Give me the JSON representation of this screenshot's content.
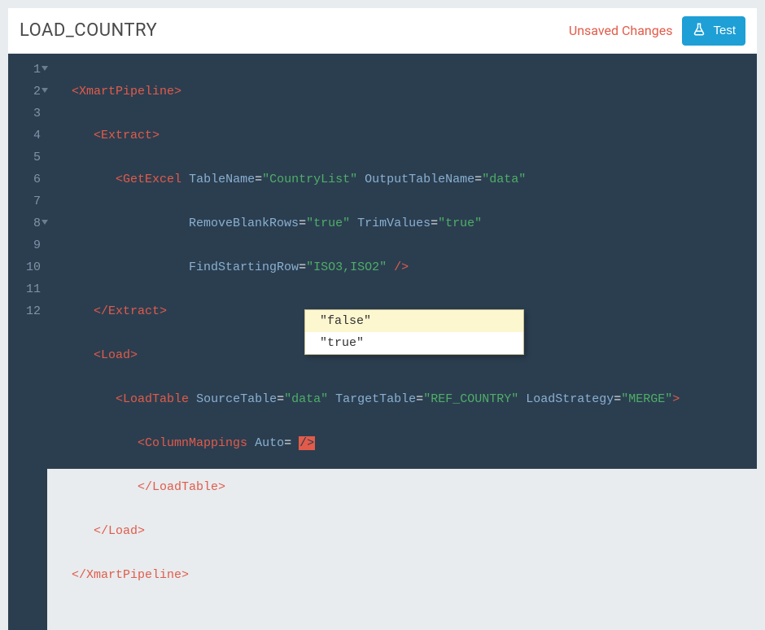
{
  "header": {
    "title": "LOAD_COUNTRY",
    "unsaved_label": "Unsaved Changes",
    "test_label": "Test"
  },
  "editor": {
    "line_numbers": [
      "1",
      "2",
      "3",
      "4",
      "5",
      "6",
      "7",
      "8",
      "9",
      "10",
      "11",
      "12"
    ],
    "fold_lines": [
      1,
      2,
      8
    ],
    "code": {
      "tag_XmartPipeline_open": "XmartPipeline",
      "tag_Extract_open": "Extract",
      "tag_GetExcel": "GetExcel",
      "attr_TableName": "TableName",
      "val_TableName": "\"CountryList\"",
      "attr_OutputTableName": "OutputTableName",
      "val_OutputTableName": "\"data\"",
      "attr_RemoveBlankRows": "RemoveBlankRows",
      "val_RemoveBlankRows": "\"true\"",
      "attr_TrimValues": "TrimValues",
      "val_TrimValues": "\"true\"",
      "attr_FindStartingRow": "FindStartingRow",
      "val_FindStartingRow": "\"ISO3,ISO2\"",
      "tag_Extract_close": "Extract",
      "tag_Load_open": "Load",
      "tag_LoadTable": "LoadTable",
      "attr_SourceTable": "SourceTable",
      "val_SourceTable": "\"data\"",
      "attr_TargetTable": "TargetTable",
      "val_TargetTable": "\"REF_COUNTRY\"",
      "attr_LoadStrategy": "LoadStrategy",
      "val_LoadStrategy": "\"MERGE\"",
      "tag_ColumnMappings": "ColumnMappings",
      "attr_Auto": "Auto",
      "cursor_region": "/>",
      "tag_LoadTable_close": "LoadTable",
      "tag_Load_close": "Load",
      "tag_XmartPipeline_close": "XmartPipeline"
    }
  },
  "suggest": {
    "options": [
      "\"false\"",
      "\"true\""
    ],
    "selected_index": 0
  }
}
